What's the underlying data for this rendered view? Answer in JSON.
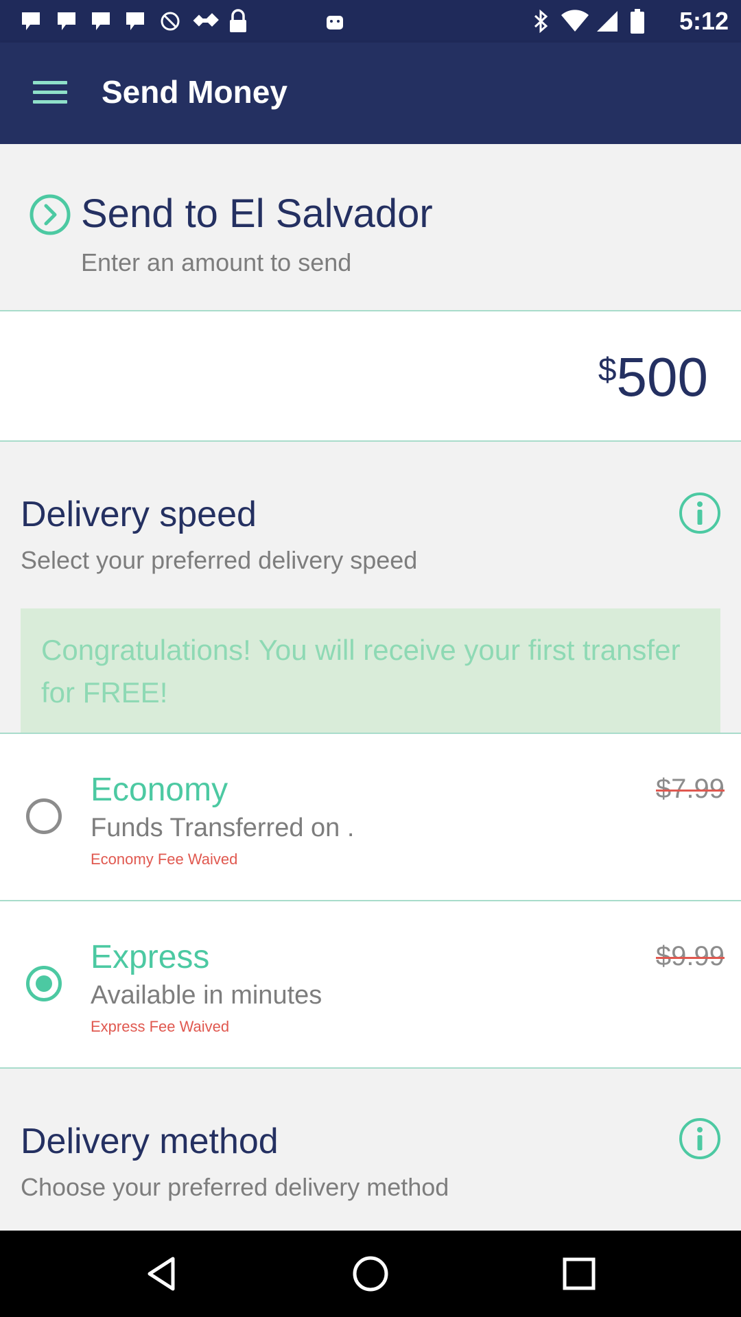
{
  "status_bar": {
    "time": "5:12"
  },
  "app_bar": {
    "title": "Send Money"
  },
  "send": {
    "title": "Send to El Salvador",
    "subtitle": "Enter an amount to send"
  },
  "amount": {
    "currency": "$",
    "value": "500"
  },
  "delivery_speed": {
    "title": "Delivery speed",
    "subtitle": "Select your preferred delivery speed",
    "promo": "Congratulations! You will receive your first transfer for FREE!",
    "options": [
      {
        "name": "Economy",
        "description": "Funds Transferred on .",
        "fee_note": "Economy Fee Waived",
        "price": "$7.99",
        "selected": false
      },
      {
        "name": "Express",
        "description": "Available in minutes",
        "fee_note": "Express Fee Waived",
        "price": "$9.99",
        "selected": true
      }
    ]
  },
  "delivery_method": {
    "title": "Delivery method",
    "subtitle": "Choose your preferred delivery method"
  },
  "colors": {
    "primary": "#243061",
    "accent": "#4cc9a2",
    "warning": "#e0584f",
    "promo_bg": "#d9ecd9"
  }
}
